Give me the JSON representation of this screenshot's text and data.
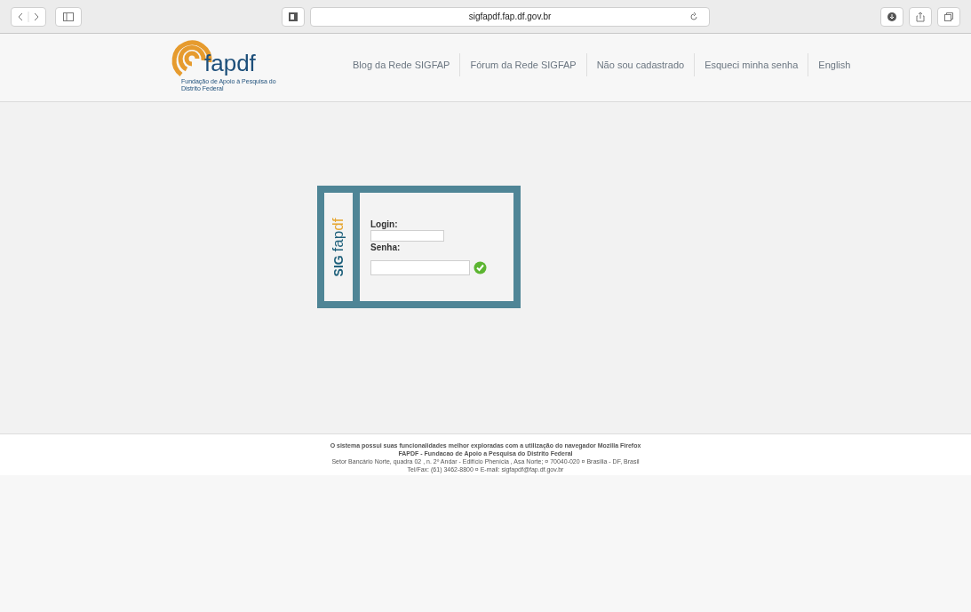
{
  "browser": {
    "url": "sigfapdf.fap.df.gov.br"
  },
  "logo": {
    "mark": "fapdf",
    "tagline": "Fundação de Apoio à Pesquisa do Distrito Federal"
  },
  "nav": [
    "Blog da Rede SIGFAP",
    "Fórum da Rede SIGFAP",
    "Não sou cadastrado",
    "Esqueci minha senha",
    "English"
  ],
  "login": {
    "side_logo_a": "SIG",
    "side_logo_b": "fap",
    "side_logo_c": "df",
    "fields": [
      {
        "label": "Login:"
      },
      {
        "label": "Senha:"
      }
    ]
  },
  "footer": [
    "O sistema possui suas funcionalidades melhor exploradas com a utilização do navegador Mozilla Firefox",
    "FAPDF - Fundacao de Apoio a Pesquisa do Distrito Federal",
    "Setor Bancário Norte, quadra 02 , n. 2º Andar - Edifício Phenícia , Asa Norte; ¤ 70040-020 ¤ Brasilia - DF, Brasil",
    "Tel/Fax: (61) 3462-8800 ¤ E-mail: sigfapdf@fap.df.gov.br"
  ]
}
